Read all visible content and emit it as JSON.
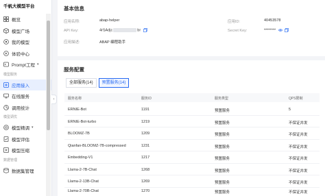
{
  "sidebar": {
    "brand": "千帆大模型平台",
    "top_items": [
      {
        "label": "概览",
        "icon": "grid-icon"
      },
      {
        "label": "模型广场",
        "icon": "cube-icon"
      },
      {
        "label": "我的模型",
        "icon": "model-icon"
      },
      {
        "label": "体验中心",
        "icon": "experience-icon"
      },
      {
        "label": "Prompt工程",
        "icon": "prompt-icon",
        "chevron": "▾"
      }
    ],
    "group_service": "模型服务",
    "service_items": [
      {
        "label": "应用接入",
        "icon": "app-access-icon",
        "active": true
      },
      {
        "label": "在线服务",
        "icon": "online-service-icon"
      },
      {
        "label": "调用统计",
        "icon": "stats-icon"
      }
    ],
    "group_tuning": "模型调优",
    "tuning_items": [
      {
        "label": "模型精调",
        "icon": "tuning-icon",
        "chevron": "▾"
      },
      {
        "label": "模型评估",
        "icon": "evaluate-icon"
      },
      {
        "label": "模型压缩",
        "icon": "compress-icon"
      }
    ],
    "group_data": "数据管理",
    "data_items": [
      {
        "label": "数据集管理",
        "icon": "dataset-icon"
      }
    ],
    "collapse_glyph": "‹"
  },
  "basic_info": {
    "title": "基本信息",
    "app_name_label": "应用名称:",
    "app_name_value": "abap-helper",
    "app_id_label": "应用ID:",
    "app_id_value": "40453578",
    "api_key_label": "API Key:",
    "api_key_prefix": "4rSAdjc",
    "api_key_suffix": "br",
    "secret_key_label": "Secret Key:",
    "secret_key_value": "********",
    "desc_label": "应用描述:",
    "desc_value": "ABAP 编程助手"
  },
  "service_config": {
    "title": "服务配置",
    "tabs": [
      {
        "label": "全部服务(14)",
        "active": false
      },
      {
        "label": "预置服务(14)",
        "active": true
      }
    ],
    "columns": [
      "服务名称",
      "服务ID",
      "服务类型",
      "QPS限制"
    ],
    "rows": [
      {
        "name": "ERNIE-Bot",
        "id": "1191",
        "type": "预置服务",
        "qps": "5"
      },
      {
        "name": "ERNIE-Bot-turbo",
        "id": "1219",
        "type": "预置服务",
        "qps": "不保证并发"
      },
      {
        "name": "BLOOMZ-7B",
        "id": "1209",
        "type": "预置服务",
        "qps": "不保证并发"
      },
      {
        "name": "Qianfan-BLOOMZ-7B-compressed",
        "id": "1231",
        "type": "预置服务",
        "qps": "不保证并发"
      },
      {
        "name": "Embedding-V1",
        "id": "1217",
        "type": "预置服务",
        "qps": "不保证并发"
      },
      {
        "name": "Llama-2-7B-Chat",
        "id": "1268",
        "type": "预置服务",
        "qps": "不保证并发"
      },
      {
        "name": "Llama-2-13B-Chat",
        "id": "1269",
        "type": "预置服务",
        "qps": "不保证并发"
      },
      {
        "name": "Llama-2-70B-Chat",
        "id": "1270",
        "type": "预置服务",
        "qps": "不保证并发"
      }
    ]
  },
  "colors": {
    "accent": "#2468f2",
    "active_bg": "#e8effe"
  }
}
